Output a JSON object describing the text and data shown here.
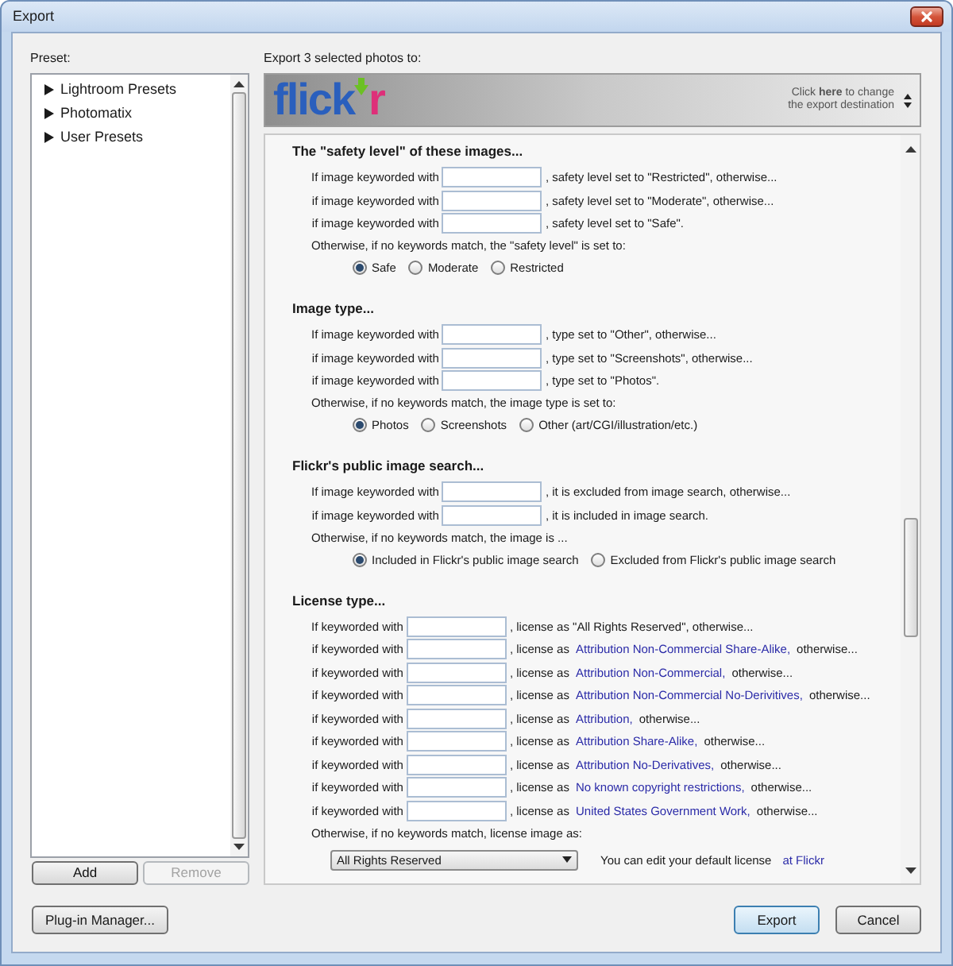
{
  "window": {
    "title": "Export"
  },
  "preset_panel": {
    "label": "Preset:",
    "items": [
      {
        "label": "Lightroom Presets",
        "expanded": false
      },
      {
        "label": "Photomatix",
        "expanded": false
      },
      {
        "label": "User Presets",
        "expanded": false
      }
    ],
    "buttons": [
      {
        "label": "Add",
        "disabled": false
      },
      {
        "label": "Remove",
        "disabled": true
      }
    ]
  },
  "destination": {
    "label": "Export 3 selected photos to:",
    "logo": [
      {
        "text": "flick",
        "color": "#2a5fbd"
      },
      {
        "text": "r",
        "color": "#de2f79"
      }
    ],
    "hint": "Click **here** to change the export destination"
  },
  "sections": [
    {
      "heading": "The \"safety level\" of these images...",
      "rules": [
        {
          "kind": "plain",
          "label": "If image keyworded with",
          "text": ", safety level set to \"Restricted\", otherwise..."
        },
        {
          "kind": "plain",
          "label": "if image keyworded with",
          "text": ", safety level set to \"Moderate\", otherwise..."
        },
        {
          "kind": "plain",
          "label": "if image keyworded with",
          "text": ", safety level set to \"Safe\"."
        }
      ],
      "fallback": {
        "kind": "radio",
        "label": "Otherwise, if no keywords match, the \"safety level\" is set to:",
        "options": [
          {
            "label": "Safe",
            "selected": true
          },
          {
            "label": "Moderate",
            "selected": false
          },
          {
            "label": "Restricted",
            "selected": false
          }
        ]
      }
    },
    {
      "heading": "Image type...",
      "rules": [
        {
          "kind": "plain",
          "label": "If image keyworded with",
          "text": ", type set to \"Other\", otherwise..."
        },
        {
          "kind": "plain",
          "label": "if image keyworded with",
          "text": ", type set to \"Screenshots\", otherwise..."
        },
        {
          "kind": "plain",
          "label": "if image keyworded with",
          "text": ", type set to \"Photos\"."
        }
      ],
      "fallback": {
        "kind": "radio",
        "label": "Otherwise, if no keywords match, the image type is set to:",
        "options": [
          {
            "label": "Photos",
            "selected": true
          },
          {
            "label": "Screenshots",
            "selected": false
          },
          {
            "label": "Other (art/CGI/illustration/etc.)",
            "selected": false
          }
        ]
      }
    },
    {
      "heading": "Flickr's public image search...",
      "rules": [
        {
          "kind": "plain",
          "label": "If image keyworded with",
          "text": ", it is excluded from image search, otherwise..."
        },
        {
          "kind": "plain",
          "label": "if image keyworded with",
          "text": ", it is included in image search."
        }
      ],
      "fallback": {
        "kind": "radio",
        "label": "Otherwise, if no keywords match, the image is ...",
        "options": [
          {
            "label": "Included in Flickr's public image search",
            "selected": true
          },
          {
            "label": "Excluded from Flickr's public image search",
            "selected": false
          }
        ]
      }
    },
    {
      "heading": "License type...",
      "rules": [
        {
          "kind": "plain",
          "label": "If keyworded with",
          "text": ", license as \"All Rights Reserved\", otherwise..."
        },
        {
          "kind": "license",
          "label": "if keyworded with",
          "text": ", license as",
          "license": "Attribution Non-Commercial Share-Alike,",
          "suffix": "otherwise..."
        },
        {
          "kind": "license",
          "label": "if keyworded with",
          "text": ", license as",
          "license": "Attribution Non-Commercial,",
          "suffix": "otherwise..."
        },
        {
          "kind": "license",
          "label": "if keyworded with",
          "text": ", license as",
          "license": "Attribution Non-Commercial No-Derivitives,",
          "suffix": "otherwise..."
        },
        {
          "kind": "license",
          "label": "if keyworded with",
          "text": ", license as",
          "license": "Attribution,",
          "suffix": "otherwise..."
        },
        {
          "kind": "license",
          "label": "if keyworded with",
          "text": ", license as",
          "license": "Attribution Share-Alike,",
          "suffix": "otherwise..."
        },
        {
          "kind": "license",
          "label": "if keyworded with",
          "text": ", license as",
          "license": "Attribution No-Derivatives,",
          "suffix": "otherwise..."
        },
        {
          "kind": "license",
          "label": "if keyworded with",
          "text": ", license as",
          "license": "No known copyright restrictions,",
          "suffix": "otherwise..."
        },
        {
          "kind": "license",
          "label": "if keyworded with",
          "text": ", license as",
          "license": "United States Government Work,",
          "suffix": "otherwise..."
        }
      ],
      "fallback": {
        "kind": "dropdown",
        "label": "Otherwise, if no keywords match, license image as:",
        "value": "All Rights Reserved",
        "note": "You can edit your default license",
        "link": "at Flickr"
      }
    }
  ],
  "plugin_manager_button": {
    "label": "Plug-in Manager..."
  },
  "dialog_buttons": [
    {
      "label": "Export",
      "default": true
    },
    {
      "label": "Cancel",
      "default": false
    }
  ]
}
